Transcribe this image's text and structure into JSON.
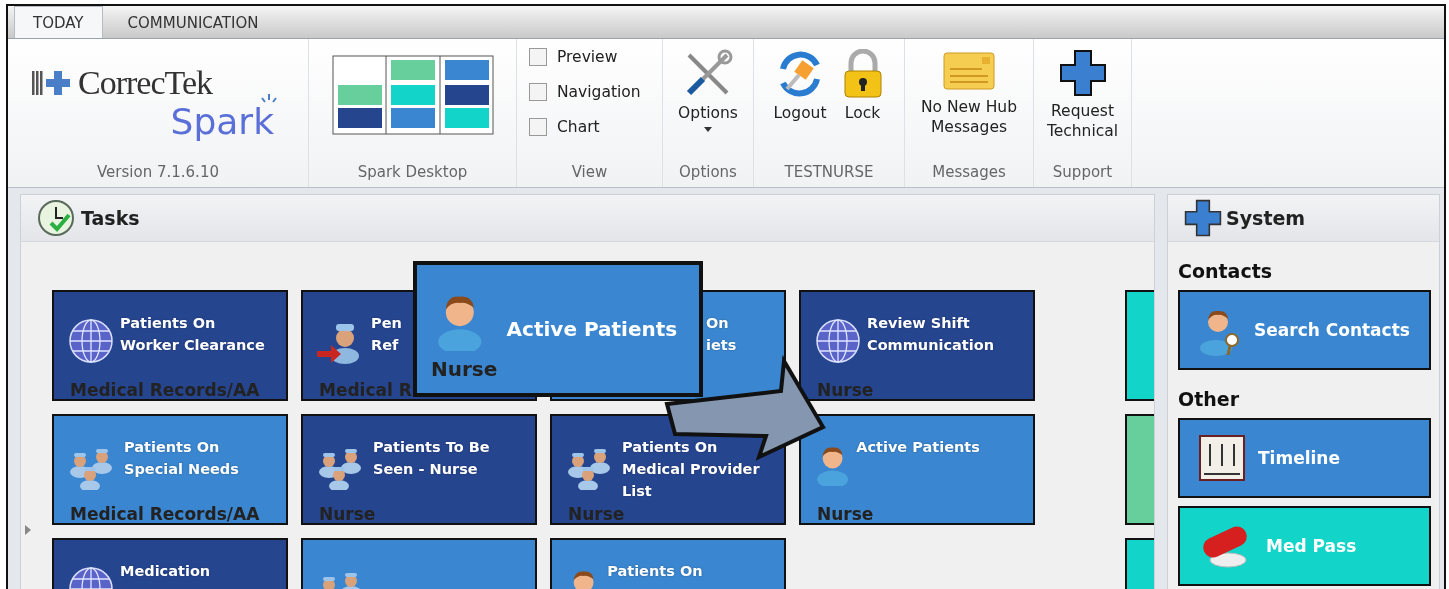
{
  "tabs": [
    {
      "label": "TODAY",
      "selected": true
    },
    {
      "label": "COMMUNICATION",
      "selected": false
    }
  ],
  "ribbon": {
    "logo": {
      "brand": "CorrecTek",
      "product": "Spark",
      "caption": "Version 7.1.6.10"
    },
    "desktop": {
      "caption": "Spark Desktop"
    },
    "view": {
      "caption": "View",
      "checkboxes": [
        {
          "label": "Preview",
          "checked": false
        },
        {
          "label": "Navigation",
          "checked": false
        },
        {
          "label": "Chart",
          "checked": false
        }
      ]
    },
    "options": {
      "caption": "Options",
      "button": "Options"
    },
    "user": {
      "caption": "TESTNURSE",
      "buttons": [
        {
          "label": "Logout",
          "kind": "logout"
        },
        {
          "label": "Lock",
          "kind": "lock"
        }
      ]
    },
    "messages": {
      "caption": "Messages",
      "button": "No New Hub Messages"
    },
    "support": {
      "caption": "Support",
      "button": "Request Technical"
    }
  },
  "tasks": {
    "title": "Tasks",
    "tiles": [
      {
        "title": "Patients On Worker Clearance",
        "role": "Medical Records/AA",
        "color": "#26458f",
        "kind": "globe"
      },
      {
        "title": "Pen Ref",
        "role": "Medical R",
        "color": "#26458f",
        "kind": "referral"
      },
      {
        "title": "On iets",
        "color": "#3a86d0",
        "kind": "covered"
      },
      {
        "title": "Review Shift Communication",
        "role": "Nurse",
        "color": "#26458f",
        "kind": "globe"
      },
      {
        "title": "Patients On Special Needs",
        "role": "Medical Records/AA",
        "color": "#3a86d0",
        "kind": "group"
      },
      {
        "title": "Patients To Be Seen - Nurse",
        "role": "Nurse",
        "color": "#26458f",
        "kind": "group"
      },
      {
        "title": "Patients On Medical Provider List",
        "role": "Nurse",
        "color": "#26458f",
        "kind": "group"
      },
      {
        "title": "Active Patients",
        "role": "Nurse",
        "color": "#3a86d0",
        "kind": "person"
      },
      {
        "title": "Medication",
        "color": "#26458f",
        "kind": "globe"
      },
      {
        "color": "#3a86d0",
        "kind": "group"
      },
      {
        "title": "Patients On",
        "color": "#3a86d0",
        "kind": "nurse"
      }
    ],
    "edge_tiles": [
      {
        "color": "#12d4c8"
      },
      {
        "color": "#66cf9c"
      },
      {
        "color": "#12d4c8"
      }
    ]
  },
  "callout": {
    "title": "Active Patients",
    "role": "Nurse"
  },
  "system": {
    "title": "System",
    "sections": [
      {
        "heading": "Contacts",
        "items": [
          {
            "label": "Search Contacts",
            "kind": "search",
            "color": "#3a86d0"
          }
        ]
      },
      {
        "heading": "Other",
        "items": [
          {
            "label": "Timeline",
            "kind": "calendar",
            "color": "#3a86d0"
          },
          {
            "label": "Med Pass",
            "kind": "pill",
            "color": "#12d4c8"
          }
        ]
      }
    ]
  }
}
